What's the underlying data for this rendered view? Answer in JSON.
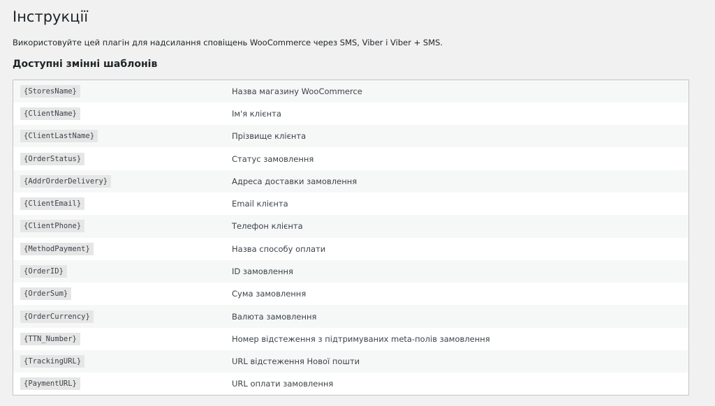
{
  "page": {
    "title": "Інструкції",
    "intro": "Використовуйте цей плагін для надсилання сповіщень WooCommerce через SMS, Viber і Viber + SMS.",
    "section_title": "Доступні змінні шаблонів"
  },
  "variables": [
    {
      "code": "{StoresName}",
      "description": "Назва магазину WooCommerce"
    },
    {
      "code": "{ClientName}",
      "description": "Ім'я клієнта"
    },
    {
      "code": "{ClientLastName}",
      "description": "Прізвище клієнта"
    },
    {
      "code": "{OrderStatus}",
      "description": "Статус замовлення"
    },
    {
      "code": "{AddrOrderDelivery}",
      "description": "Адреса доставки замовлення"
    },
    {
      "code": "{ClientEmail}",
      "description": "Email клієнта"
    },
    {
      "code": "{ClientPhone}",
      "description": "Телефон клієнта"
    },
    {
      "code": "{MethodPayment}",
      "description": "Назва способу оплати"
    },
    {
      "code": "{OrderID}",
      "description": "ID замовлення"
    },
    {
      "code": "{OrderSum}",
      "description": "Сума замовлення"
    },
    {
      "code": "{OrderCurrency}",
      "description": "Валюта замовлення"
    },
    {
      "code": "{TTN_Number}",
      "description": "Номер відстеження з підтримуваних meta-полів замовлення"
    },
    {
      "code": "{TrackingURL}",
      "description": "URL відстеження Нової пошти"
    },
    {
      "code": "{PaymentURL}",
      "description": "URL оплати замовлення"
    }
  ]
}
